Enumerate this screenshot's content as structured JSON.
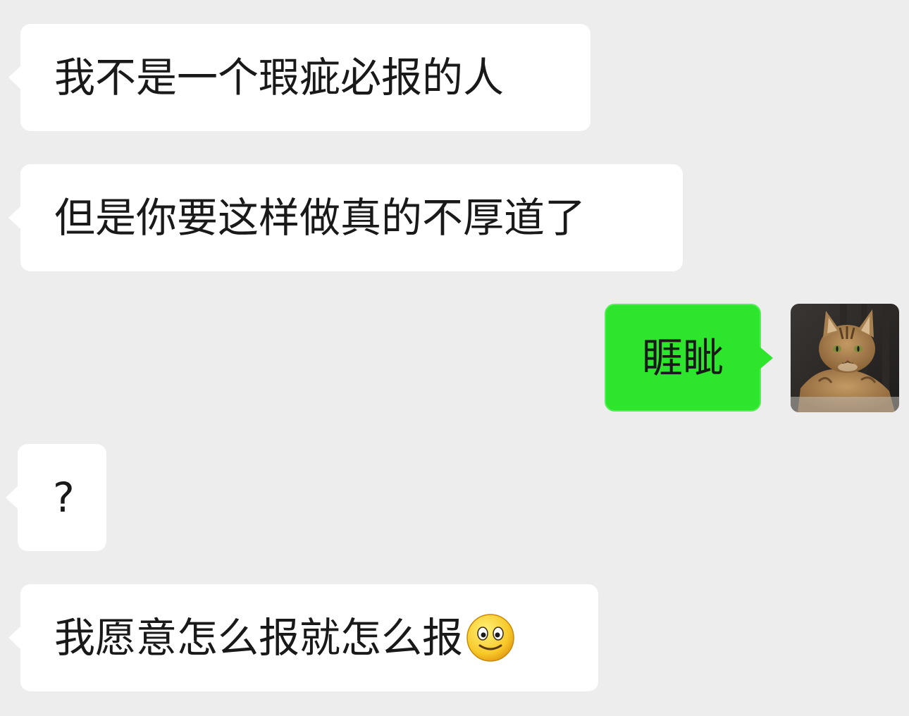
{
  "messages": [
    {
      "sender": "other",
      "text": "我不是一个瑕疵必报的人"
    },
    {
      "sender": "other",
      "text": "但是你要这样做真的不厚道了"
    },
    {
      "sender": "self",
      "text": "睚眦",
      "avatar": "cat-avatar"
    },
    {
      "sender": "other",
      "text": "?"
    },
    {
      "sender": "other",
      "text": "我愿意怎么报就怎么报",
      "emoji": "smiley-emoji"
    }
  ],
  "colors": {
    "background": "#ededed",
    "incoming_bubble": "#ffffff",
    "outgoing_bubble": "#2ee52e",
    "text": "#191919"
  }
}
